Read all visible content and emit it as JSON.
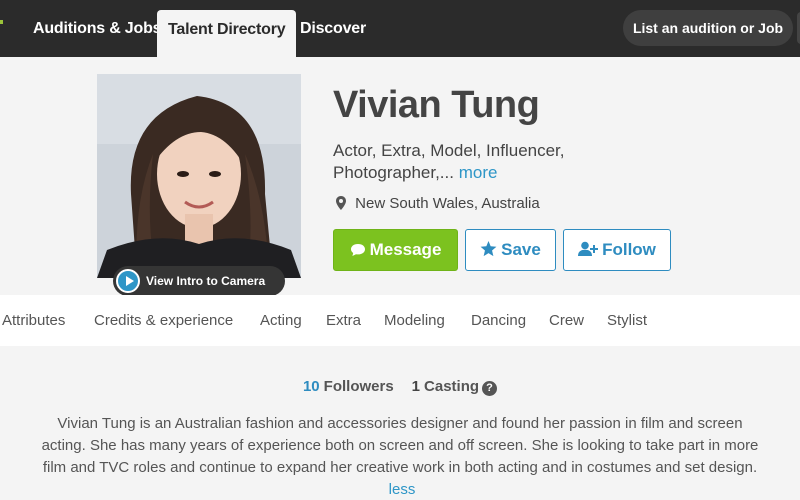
{
  "nav": {
    "tabs": [
      {
        "label": "Auditions & Jobs"
      },
      {
        "label": "Talent Directory"
      },
      {
        "label": "Discover"
      }
    ],
    "cta_label": "List an audition or Job"
  },
  "profile": {
    "name": "Vivian Tung",
    "roles": "Actor, Extra, Model, Influencer, Photographer,...",
    "more_label": "more",
    "location": "New South Wales, Australia",
    "intro_label": "View Intro to Camera",
    "icons": {
      "play": "play-circle-icon",
      "pin": "map-pin-icon",
      "message": "chat-bubble-icon",
      "save": "star-icon",
      "follow": "user-plus-icon",
      "help": "question-circle-icon"
    }
  },
  "actions": {
    "message_label": "Message",
    "save_label": "Save",
    "follow_label": "Follow"
  },
  "profile_tabs": [
    {
      "label": "Attributes"
    },
    {
      "label": "Credits & experience"
    },
    {
      "label": "Acting"
    },
    {
      "label": "Extra"
    },
    {
      "label": "Modeling"
    },
    {
      "label": "Dancing"
    },
    {
      "label": "Crew"
    },
    {
      "label": "Stylist"
    }
  ],
  "stats": {
    "followers_count": "10",
    "followers_label": "Followers",
    "casting_count": "1",
    "casting_label": "Casting"
  },
  "bio": {
    "text": "Vivian Tung is an Australian fashion and accessories designer and found her passion in film and screen acting. She has many years of experience both on screen and off screen. She is looking to take part in more film and TVC roles and continue to expand her creative work in both acting and in costumes and set design.",
    "less_label": "less"
  },
  "colors": {
    "nav_bg": "#2b2b2b",
    "accent_blue": "#2e8cc0",
    "message_green": "#7cc21f",
    "page_bg": "#f4f4f4"
  }
}
